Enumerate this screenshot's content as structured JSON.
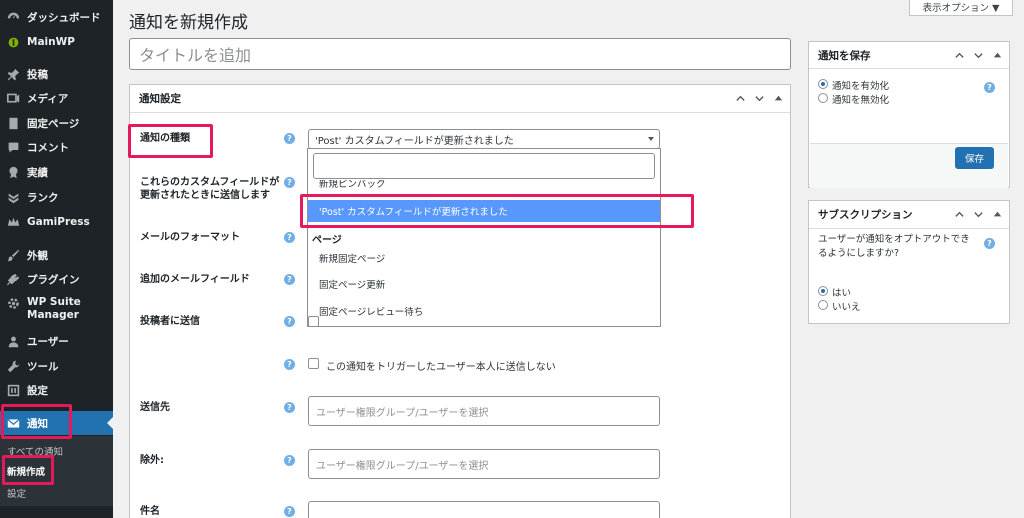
{
  "sidebar": {
    "items": [
      {
        "label": "ダッシュボード",
        "icon": "dashboard-icon"
      },
      {
        "label": "MainWP",
        "icon": "mainwp-icon"
      },
      {
        "label": "投稿",
        "icon": "pin-icon"
      },
      {
        "label": "メディア",
        "icon": "media-icon"
      },
      {
        "label": "固定ページ",
        "icon": "page-icon"
      },
      {
        "label": "コメント",
        "icon": "comment-icon"
      },
      {
        "label": "実績",
        "icon": "award-icon"
      },
      {
        "label": "ランク",
        "icon": "rank-icon"
      },
      {
        "label": "GamiPress",
        "icon": "gamipress-icon"
      },
      {
        "label": "外観",
        "icon": "brush-icon"
      },
      {
        "label": "プラグイン",
        "icon": "plugin-icon"
      },
      {
        "label": "WP Suite Manager",
        "icon": "gear-icon"
      },
      {
        "label": "ユーザー",
        "icon": "user-icon"
      },
      {
        "label": "ツール",
        "icon": "wrench-icon"
      },
      {
        "label": "設定",
        "icon": "settings-icon"
      },
      {
        "label": "通知",
        "icon": "mail-icon"
      }
    ],
    "submenu": [
      "すべての通知",
      "新規作成",
      "設定"
    ]
  },
  "page": {
    "title": "通知を新規作成",
    "screen_options": "表示オプション ▼",
    "title_placeholder": "タイトルを追加"
  },
  "settings_box": {
    "title": "通知設定",
    "fields": {
      "type_label": "通知の種類",
      "type_value": "'Post' カスタムフィールドが更新されました",
      "custom_fields_label": "これらのカスタムフィールドが更新されたときに送信します",
      "email_format_label": "メールのフォーマット",
      "extra_email_label": "追加のメールフィールド",
      "send_author_label": "投稿者に送信",
      "no_trigger_user_label": "この通知をトリガーしたユーザー本人に送信しない",
      "recipients_label": "送信先",
      "recipients_placeholder": "ユーザー権限グループ/ユーザーを選択",
      "exclude_label": "除外:",
      "exclude_placeholder": "ユーザー権限グループ/ユーザーを選択",
      "subject_label": "件名"
    },
    "dropdown": {
      "clipped_option": "新規ピンバック",
      "selected_option": "'Post' カスタムフィールドが更新されました",
      "group_label": "ページ",
      "options": [
        "新規固定ページ",
        "固定ページ更新",
        "固定ページレビュー待ち"
      ]
    }
  },
  "save_box": {
    "title": "通知を保存",
    "enabled_label": "通知を有効化",
    "disabled_label": "通知を無効化",
    "save_label": "保存"
  },
  "subscription_box": {
    "title": "サブスクリプション",
    "question": "ユーザーが通知をオプトアウトできるようにしますか?",
    "yes_label": "はい",
    "no_label": "いいえ"
  },
  "help_glyph": "?",
  "colors": {
    "highlight": "#e6195a",
    "admin_blue": "#2271b1",
    "selected_option": "#5897fb",
    "sidebar_bg": "#1d2327"
  }
}
